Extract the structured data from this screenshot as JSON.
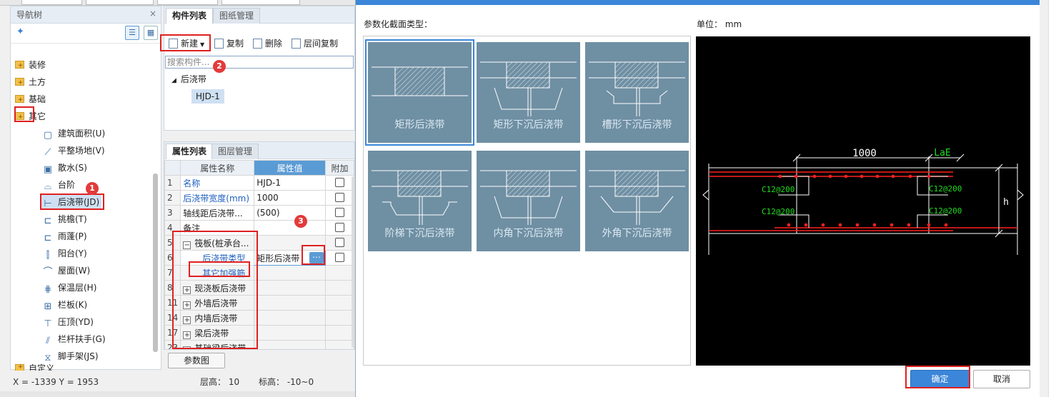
{
  "nav": {
    "title": "导航树",
    "close": "×",
    "folders": [
      "装修",
      "土方",
      "基础",
      "其它"
    ],
    "items": [
      {
        "label": "建筑面积(U)",
        "icon": "area-icon"
      },
      {
        "label": "平整场地(V)",
        "icon": "site-level-icon"
      },
      {
        "label": "散水(S)",
        "icon": "apron-icon"
      },
      {
        "label": "台阶",
        "icon": "step-icon"
      },
      {
        "label": "后浇带(JD)",
        "icon": "post-cast-strip-icon"
      },
      {
        "label": "挑檐(T)",
        "icon": "eave-icon"
      },
      {
        "label": "雨蓬(P)",
        "icon": "canopy-icon"
      },
      {
        "label": "阳台(Y)",
        "icon": "balcony-icon"
      },
      {
        "label": "屋面(W)",
        "icon": "roof-icon"
      },
      {
        "label": "保温层(H)",
        "icon": "insulation-icon"
      },
      {
        "label": "栏板(K)",
        "icon": "parapet-icon"
      },
      {
        "label": "压顶(YD)",
        "icon": "coping-icon"
      },
      {
        "label": "栏杆扶手(G)",
        "icon": "railing-icon"
      },
      {
        "label": "脚手架(JS)",
        "icon": "scaffold-icon"
      }
    ],
    "last_folder": "自定义"
  },
  "complist": {
    "tab_active": "构件列表",
    "tab_other": "图纸管理",
    "new": "新建",
    "copy": "复制",
    "delete": "删除",
    "floor_copy": "层间复制",
    "search_placeholder": "搜索构件...",
    "tree_root": "后浇带",
    "tree_child": "HJD-1"
  },
  "proplist": {
    "tab_active": "属性列表",
    "tab_other": "图层管理",
    "col_name": "属性名称",
    "col_value": "属性值",
    "col_extra": "附加",
    "rows": [
      {
        "num": "1",
        "name": "名称",
        "value": "HJD-1"
      },
      {
        "num": "2",
        "name": "后浇带宽度(mm)",
        "value": "1000"
      },
      {
        "num": "3",
        "name": "轴线距后浇带...",
        "value": "(500)"
      },
      {
        "num": "4",
        "name": "备注",
        "value": ""
      },
      {
        "num": "5",
        "name": "筏板(桩承台...",
        "value": ""
      },
      {
        "num": "6",
        "name": "后浇带类型",
        "value": "矩形后浇带"
      },
      {
        "num": "7",
        "name": "其它加强筋",
        "value": ""
      },
      {
        "num": "8",
        "name": "现浇板后浇带",
        "value": ""
      },
      {
        "num": "11",
        "name": "外墙后浇带",
        "value": ""
      },
      {
        "num": "14",
        "name": "内墙后浇带",
        "value": ""
      },
      {
        "num": "17",
        "name": "梁后浇带",
        "value": ""
      },
      {
        "num": "23",
        "name": "基础梁后浇带",
        "value": ""
      }
    ],
    "param_button": "参数图"
  },
  "status": {
    "coords": "X = -1339 Y = 1953",
    "floor_height": "层高： 10",
    "elevation": "标高： -10~0"
  },
  "dialog": {
    "section_label": "参数化截面类型：",
    "unit_label": "单位：  mm",
    "types": [
      "矩形后浇带",
      "矩形下沉后浇带",
      "槽形下沉后浇带",
      "阶梯下沉后浇带",
      "内角下沉后浇带",
      "外角下沉后浇带"
    ],
    "selected_index": 0,
    "ok": "确定",
    "cancel": "取消"
  },
  "preview": {
    "width_label": "1000",
    "lae_label": "LaE",
    "rebar_tl": "C12@200",
    "rebar_tr": "C12@200",
    "rebar_bl": "C12@200",
    "rebar_br": "C12@200",
    "h_label": "h"
  },
  "annotations": [
    "1",
    "2",
    "3"
  ],
  "colors": {
    "accent": "#3b86d9",
    "highlight": "#e02020",
    "cell_bg": "#6f8fa3",
    "rebar": "#ff2020",
    "dim": "#ffffff",
    "label_green": "#22dd22"
  }
}
